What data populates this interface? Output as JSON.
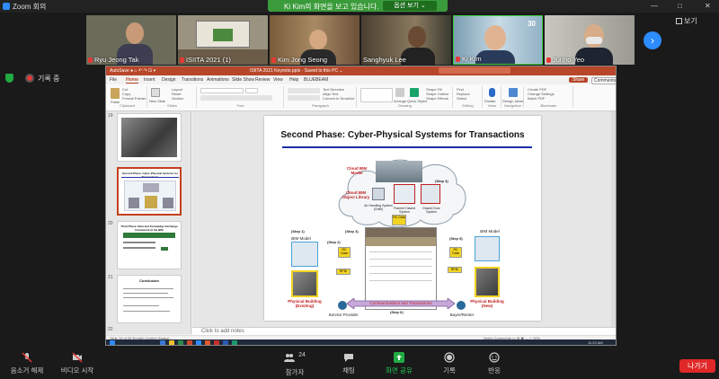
{
  "window": {
    "title": "Zoom 회의",
    "controls": [
      "—",
      "□",
      "✕"
    ],
    "view_button": "보기"
  },
  "share_banner": {
    "text": "Ki Kim의 화면을 보고 있습니다.",
    "options": "옵션 보기 ⌄"
  },
  "participants": [
    {
      "name": "Ryu Jeong Tak",
      "muted": true
    },
    {
      "name": "ISIITA 2021 (1)",
      "muted": true
    },
    {
      "name": "Kim Jong Seong",
      "muted": true
    },
    {
      "name": "Sanghyuk Lee",
      "muted": false
    },
    {
      "name": "Ki Kim",
      "muted": true
    },
    {
      "name": "Junho Yeo",
      "muted": true
    }
  ],
  "recording": {
    "label": "기록 중"
  },
  "powerpoint": {
    "titlebar_left": "AutoSave  ●  ⌂  ↶  ↷  ⊡  ▾",
    "titlebar_center": "ISIITA 2021 Keynote.pptx  ·  Saved to this PC ⌄",
    "tabs": [
      "File",
      "Home",
      "Insert",
      "Design",
      "Transitions",
      "Animations",
      "Slide Show",
      "Review",
      "View",
      "Help",
      "BLUEBEAM"
    ],
    "selected_tab": "Home",
    "share_label": "Share",
    "comments_label": "Comments",
    "ribbon_groups": [
      "Clipboard",
      "Slides",
      "Font",
      "Paragraph",
      "Drawing",
      "Editing",
      "Voice",
      "Navigation",
      "Bluebeam"
    ],
    "ribbon_buttons": {
      "paste": "Paste",
      "cut": "Cut",
      "copy": "Copy",
      "format_painter": "Format Painter",
      "new_slide": "New Slide",
      "layout": "Layout",
      "reset": "Reset",
      "section": "Section",
      "text_direction": "Text Direction",
      "align_text": "Align Text",
      "convert_smartart": "Convert to SmartArt",
      "arrange": "Arrange",
      "quick_styles": "Quick Styles",
      "shape_fill": "Shape Fill",
      "shape_outline": "Shape Outline",
      "shape_effects": "Shape Effects",
      "find": "Find",
      "replace": "Replace",
      "select": "Select",
      "dictate": "Dictate",
      "design_ideas": "Design Ideas",
      "create_pdf": "Create PDF",
      "change_settings": "Change Settings",
      "batch_pdf": "Batch PDF"
    },
    "thumbnails": [
      {
        "num": "19",
        "title": ""
      },
      {
        "num": "",
        "title": "Second Phase: Cyber-Physical Systems for Transactions"
      },
      {
        "num": "20",
        "title": "Third Phase: Data and Knowledge Exchange Framework at the BIM"
      },
      {
        "num": "21",
        "title": "Conclusion"
      }
    ],
    "thumb_pages": [
      "19",
      "20",
      "21",
      "22"
    ],
    "slide": {
      "title": "Second Phase: Cyber-Physical Systems for Transactions",
      "cloud_bim_model": "Cloud BIM Model",
      "cloud_bim_object_library": "Cloud BIM Object Library",
      "air_handling": "Air Handling System (Grille)",
      "framed_glazed": "Framed Glazed System",
      "glazed_door": "Glazed Door System",
      "step1": "(Step 1)",
      "step2": "(Step 2)",
      "step3": "(Step 3)",
      "step4": "(Step 4)",
      "step5": "(Step 5)",
      "step6": "(Step 6)",
      "bim_model_left": "BIM Model",
      "bim_model_right": "BIM Model",
      "rc_data_left": "RC Data",
      "rc_data_center": "RC Data",
      "rc_data_right": "RC Data",
      "rfid_left": "RFID",
      "rfid_right": "RFID",
      "physical_existing": "Physical Building (Existing)",
      "physical_new": "Physical Building (New)",
      "service_provider": "Service Provider",
      "buyer_renter": "Buyer/Renter",
      "communications": "Communications and Transactions"
    },
    "notes_placeholder": "Click to add notes",
    "status_left": "Slide 19 of 26   English (United States)",
    "status_right": "Notes   Comments   ▭  ⊞  ▣  —  +  70%",
    "clock": "11:22 AM"
  },
  "toolbar": {
    "unmute": "음소거 해제",
    "video": "비디오 시작",
    "participants": "참가자",
    "participants_count": "24",
    "chat": "채팅",
    "share_screen": "화면 공유",
    "record": "기록",
    "reactions": "반응",
    "leave": "나가기"
  },
  "colors": {
    "ppt_brand": "#b7472a",
    "share_green": "#3a9b3a",
    "leave_red": "#e02828",
    "zoom_blue": "#2d8cff",
    "slide_underline": "#1a2fa8",
    "diagram_label_red": "#c02020"
  }
}
